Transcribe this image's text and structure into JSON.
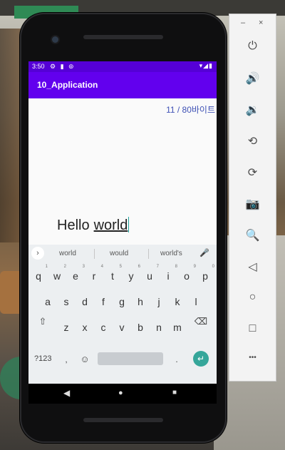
{
  "status_bar": {
    "time": "3:50",
    "left_icons": "⚙ ▮ ⊚",
    "right_icons": "▾◢▮"
  },
  "app": {
    "title": "10_Application",
    "counter": "11 / 80바이트",
    "edit_text_word1": "Hello",
    "edit_text_word2": "world"
  },
  "keyboard": {
    "suggestions": [
      "world",
      "would",
      "world's"
    ],
    "row1": [
      {
        "k": "q",
        "h": "1"
      },
      {
        "k": "w",
        "h": "2"
      },
      {
        "k": "e",
        "h": "3"
      },
      {
        "k": "r",
        "h": "4"
      },
      {
        "k": "t",
        "h": "5"
      },
      {
        "k": "y",
        "h": "6"
      },
      {
        "k": "u",
        "h": "7"
      },
      {
        "k": "i",
        "h": "8"
      },
      {
        "k": "o",
        "h": "9"
      },
      {
        "k": "p",
        "h": "0"
      }
    ],
    "row2": [
      "a",
      "s",
      "d",
      "f",
      "g",
      "h",
      "j",
      "k",
      "l"
    ],
    "row3": [
      "z",
      "x",
      "c",
      "v",
      "b",
      "n",
      "m"
    ],
    "symbols_key": "?123",
    "comma_key": ",",
    "period_key": ".",
    "shift_icon": "⇧",
    "backspace_icon": "⌫",
    "emoji_icon": "☺",
    "enter_icon": "↵",
    "mic_icon": "🎤",
    "expand_icon": "›"
  },
  "nav_bar": {
    "back_icon": "◀",
    "home_icon": "●",
    "recents_icon": "■"
  },
  "emulator_panel": {
    "minimize_label": "–",
    "close_label": "×",
    "controls": [
      {
        "name": "power-icon",
        "glyph": "⏻"
      },
      {
        "name": "volume-up-icon",
        "glyph": "🔊"
      },
      {
        "name": "volume-down-icon",
        "glyph": "🔉"
      },
      {
        "name": "rotate-left-icon",
        "glyph": "⟲"
      },
      {
        "name": "rotate-right-icon",
        "glyph": "⟳"
      },
      {
        "name": "camera-icon",
        "glyph": "📷"
      },
      {
        "name": "zoom-icon",
        "glyph": "🔍"
      },
      {
        "name": "back-icon",
        "glyph": "◁"
      },
      {
        "name": "home-icon",
        "glyph": "○"
      },
      {
        "name": "overview-icon",
        "glyph": "□"
      },
      {
        "name": "more-icon",
        "glyph": "•••"
      }
    ]
  },
  "colors": {
    "status_bar": "#5500d6",
    "app_bar": "#6200ee",
    "counter_text": "#3f51b5",
    "cursor": "#1fa39c",
    "enter_key": "#35a69a"
  }
}
